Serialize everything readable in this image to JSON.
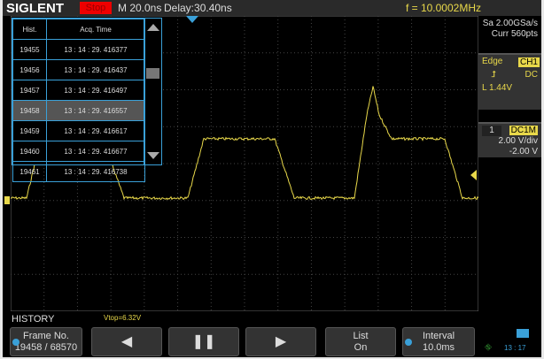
{
  "header": {
    "logo": "SIGLENT",
    "run_state": "Stop",
    "timebase": "M 20.0ns",
    "delay": "Delay:30.40ns",
    "frequency": "f = 10.0002MHz"
  },
  "history_list": {
    "columns": [
      "Hist.",
      "Acq. Time"
    ],
    "rows": [
      [
        "19455",
        "13 : 14 : 29. 416377"
      ],
      [
        "19456",
        "13 : 14 : 29. 416437"
      ],
      [
        "19457",
        "13 : 14 : 29. 416497"
      ],
      [
        "19458",
        "13 : 14 : 29. 416557"
      ],
      [
        "19459",
        "13 : 14 : 29. 416617"
      ],
      [
        "19460",
        "13 : 14 : 29. 416677"
      ],
      [
        "19461",
        "13 : 14 : 29. 416738"
      ]
    ],
    "selected_row": "19458"
  },
  "acquisition": {
    "sample_rate": "Sa 2.00GSa/s",
    "memory": "Curr 560pts"
  },
  "trigger": {
    "type": "Edge",
    "source": "CH1",
    "coupling": "DC",
    "level": "L  1.44V",
    "slope": "rising"
  },
  "channel": {
    "number": "1",
    "coupling": "DC1M",
    "scale": "2.00 V/div",
    "offset": "-2.00 V"
  },
  "measurement": {
    "label": "HISTORY",
    "vtop": "Vtop=6.32V"
  },
  "menu": [
    {
      "line1": "Frame No.",
      "line2": "19458 / 68570"
    },
    {
      "icon": "previous-icon",
      "line1": "◀",
      "line2": ""
    },
    {
      "icon": "pause-icon",
      "line1": "❚❚",
      "line2": ""
    },
    {
      "icon": "next-icon",
      "line1": "▶",
      "line2": ""
    },
    {
      "line1": "List",
      "line2": "On"
    },
    {
      "line1": "Interval",
      "line2": "10.0ms"
    }
  ],
  "status": {
    "time": "13 : 17"
  },
  "colors": {
    "trace": "#e8d84a",
    "accent": "#3aa0d8",
    "stop": "#e00000"
  }
}
